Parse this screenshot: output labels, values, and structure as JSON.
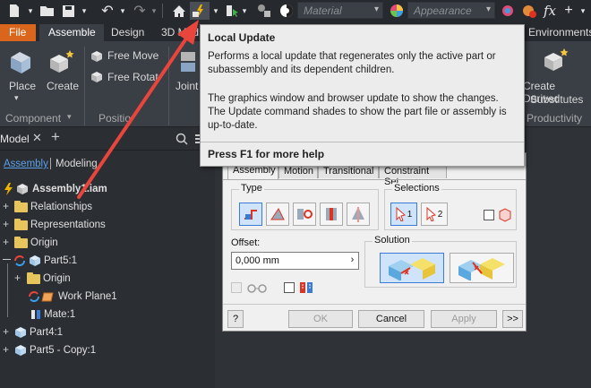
{
  "qat": {
    "material_placeholder": "Material",
    "appearance_placeholder": "Appearance",
    "fx_label": "fx"
  },
  "tabs": {
    "file": "File",
    "assemble": "Assemble",
    "design": "Design",
    "model": "3D Mod",
    "environments": "Environments"
  },
  "ribbon": {
    "place": "Place",
    "create": "Create",
    "free_move": "Free Move",
    "free_rotate": "Free Rotat",
    "joint": "Joint",
    "create_derived": "Create Derived",
    "substitutes": "Substitutes",
    "group_component": "Component",
    "group_position": "Positio",
    "group_productivity": "Productivity"
  },
  "browser": {
    "tab_model": "Model",
    "view_assembly": "Assembly",
    "view_modeling": "Modeling",
    "root": "Assembly1.iam",
    "items": [
      {
        "label": "Relationships"
      },
      {
        "label": "Representations"
      },
      {
        "label": "Origin"
      },
      {
        "label": "Part5:1"
      },
      {
        "label": "Origin"
      },
      {
        "label": "Work Plane1"
      },
      {
        "label": "Mate:1"
      },
      {
        "label": "Part4:1"
      },
      {
        "label": "Part5 - Copy:1"
      }
    ]
  },
  "dialog": {
    "tabs": [
      "Assembly",
      "Motion",
      "Transitional",
      "Constraint Set"
    ],
    "type_label": "Type",
    "selections_label": "Selections",
    "sel1": "1",
    "sel2": "2",
    "offset_label": "Offset:",
    "offset_value": "0,000 mm",
    "solution_label": "Solution",
    "help_label": "?",
    "ok": "OK",
    "cancel": "Cancel",
    "apply": "Apply",
    "more": ">>"
  },
  "tooltip": {
    "title": "Local Update",
    "desc": "Performs a local update that regenerates only the active part or subassembly and its dependent children.",
    "details": "The graphics window and browser update to show the changes. The Update command shades to show the part file or assembly is up-to-date.",
    "help": "Press F1 for more help"
  },
  "colors": {
    "file_tab": "#d9661c",
    "accent_blue": "#3a7bd5",
    "arrow": "#e8453c"
  }
}
